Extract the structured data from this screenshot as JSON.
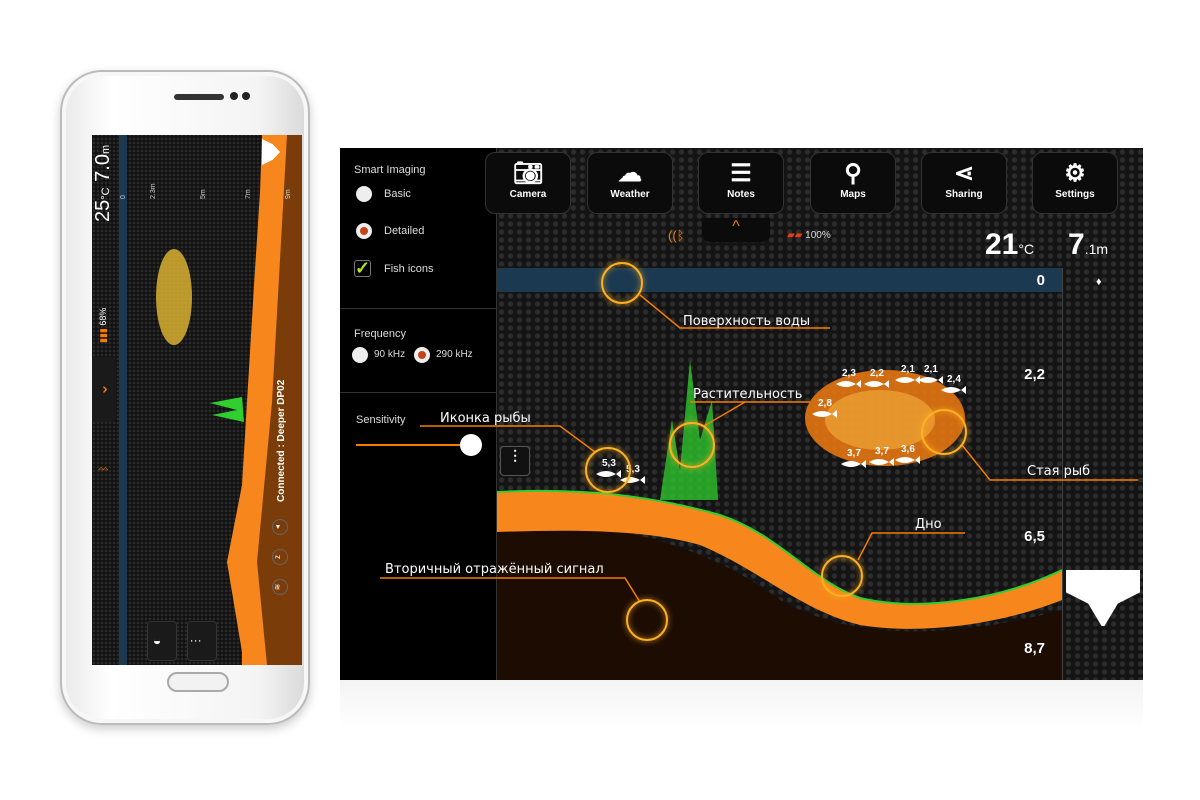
{
  "phone": {
    "temperature": "25",
    "temp_unit": "°C",
    "depth": "7.0",
    "depth_unit": "m",
    "scale": [
      "0",
      "2.3m",
      "5m",
      "7m",
      "9m"
    ],
    "battery": "68%",
    "connection": "Connected : Deeper DP02",
    "icons": [
      "bluetooth-icon",
      "chevron-down-icon",
      "battery-icon",
      "sonar-icon",
      "zzz-icon",
      "vibration-icon",
      "contrast-icon",
      "sliders-icon"
    ]
  },
  "panel": {
    "smart_imaging": "Smart Imaging",
    "basic": "Basic",
    "detailed": "Detailed",
    "fish_icons": "Fish icons",
    "imaging_selected": "Detailed",
    "fish_icons_checked": true,
    "frequency": "Frequency",
    "freq_90": "90 kHz",
    "freq_290": "290 kHz",
    "freq_selected": "290 kHz",
    "sensitivity": "Sensitivity",
    "sensitivity_level": 0.9
  },
  "toolbar": [
    {
      "label": "Camera",
      "icon": "camera-icon"
    },
    {
      "label": "Weather",
      "icon": "weather-icon"
    },
    {
      "label": "Notes",
      "icon": "notes-icon"
    },
    {
      "label": "Maps",
      "icon": "map-pin-icon"
    },
    {
      "label": "Sharing",
      "icon": "share-icon"
    },
    {
      "label": "Settings",
      "icon": "gear-icon"
    }
  ],
  "status": {
    "battery": "100%",
    "temperature": "21",
    "temp_unit": "°C",
    "depth": "7",
    "depth_decimal": ".1m"
  },
  "depth_scale": [
    "0",
    "2,2",
    "6,5",
    "8,7"
  ],
  "fish": [
    "2,3",
    "2,2",
    "2,1",
    "2,1",
    "2,4",
    "2,8",
    "3,7",
    "3,7",
    "3,6",
    "5,3",
    "5,3"
  ],
  "annotations": {
    "surface": "Поверхность воды",
    "vegetation": "Растительность",
    "fish_icon": "Иконка рыбы",
    "school": "Стая рыб",
    "bottom": "Дно",
    "secondary": "Вторичный отражённый сигнал"
  },
  "colors": {
    "accent": "#f57c00",
    "bottom": "#f7861c",
    "vegetation": "#2fcf2f",
    "water": "#1b3a52",
    "check": "#b5e61d"
  }
}
